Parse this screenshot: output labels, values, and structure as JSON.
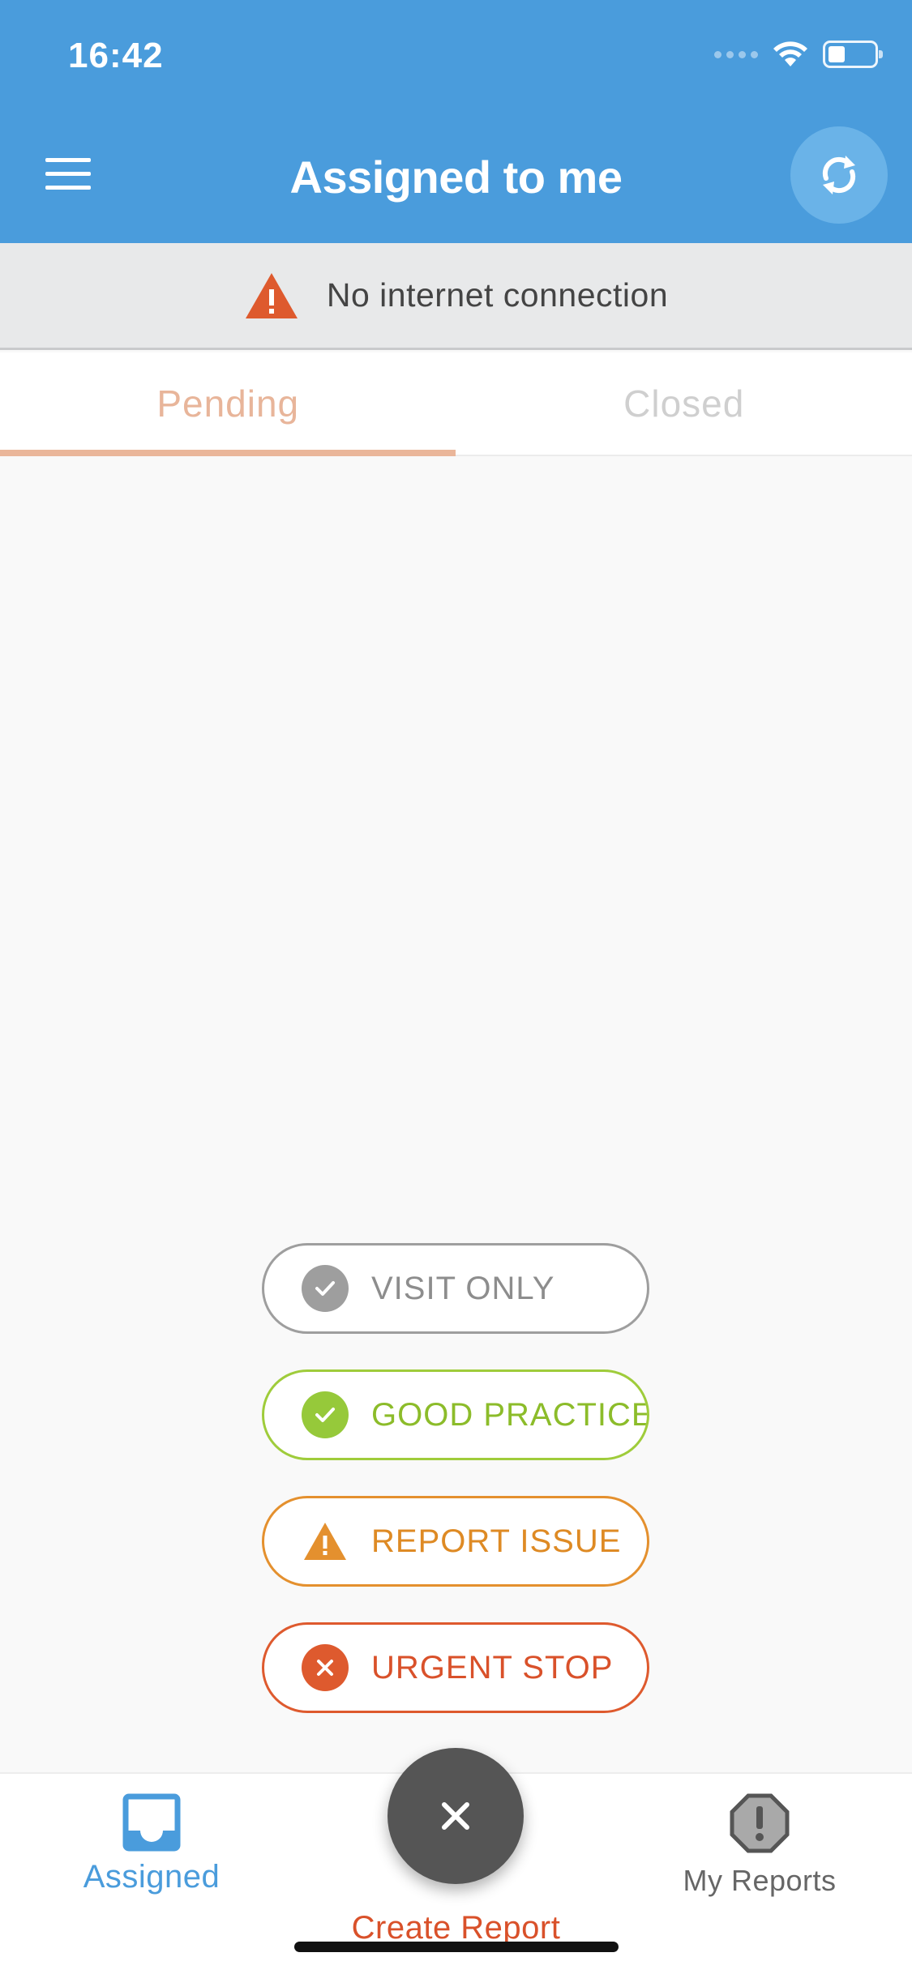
{
  "status_bar": {
    "time": "16:42"
  },
  "header": {
    "title": "Assigned to me",
    "menu_icon": "hamburger-menu-icon",
    "sync_icon": "sync-icon"
  },
  "offline_banner": {
    "text": "No internet connection",
    "icon": "warning-triangle-icon"
  },
  "tabs": [
    {
      "label": "Pending",
      "selected": true
    },
    {
      "label": "Closed",
      "selected": false
    }
  ],
  "actions": {
    "visit_only": "VISIT ONLY",
    "good_practice": "GOOD PRACTICE",
    "report_issue": "REPORT ISSUE",
    "urgent_stop": "URGENT STOP"
  },
  "bottom_nav": {
    "assigned_label": "Assigned",
    "create_label": "Create Report",
    "my_reports_label": "My Reports"
  },
  "colors": {
    "header_blue": "#4a9cdc",
    "tab_active": "#eab69a",
    "visit_gray": "#9e9e9e",
    "good_green": "#96c93a",
    "issue_orange": "#e4902e",
    "urgent_red": "#de5a2e",
    "fab_dark": "#555555"
  }
}
